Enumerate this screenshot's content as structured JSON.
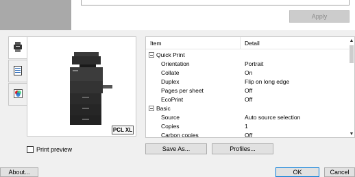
{
  "top": {
    "apply_label": "Apply"
  },
  "tabs": [
    {
      "icon": "printer-icon"
    },
    {
      "icon": "document-icon"
    },
    {
      "icon": "color-icon"
    }
  ],
  "preview": {
    "pcl_label": "PCL XL",
    "print_preview_label": "Print preview"
  },
  "grid": {
    "col_item": "Item",
    "col_detail": "Detail",
    "rows": [
      {
        "type": "group",
        "item": "Quick Print",
        "detail": ""
      },
      {
        "type": "child",
        "item": "Orientation",
        "detail": "Portrait"
      },
      {
        "type": "child",
        "item": "Collate",
        "detail": "On"
      },
      {
        "type": "child",
        "item": "Duplex",
        "detail": "Flip on long edge"
      },
      {
        "type": "child",
        "item": "Pages per sheet",
        "detail": "Off"
      },
      {
        "type": "child",
        "item": "EcoPrint",
        "detail": "Off"
      },
      {
        "type": "group",
        "item": "Basic",
        "detail": ""
      },
      {
        "type": "child",
        "item": "Source",
        "detail": "Auto source selection"
      },
      {
        "type": "child",
        "item": "Copies",
        "detail": "1"
      },
      {
        "type": "child",
        "item": "Carbon copies",
        "detail": "Off"
      }
    ]
  },
  "buttons": {
    "save_as": "Save As...",
    "profiles": "Profiles...",
    "about": "About...",
    "ok": "OK",
    "cancel": "Cancel"
  }
}
